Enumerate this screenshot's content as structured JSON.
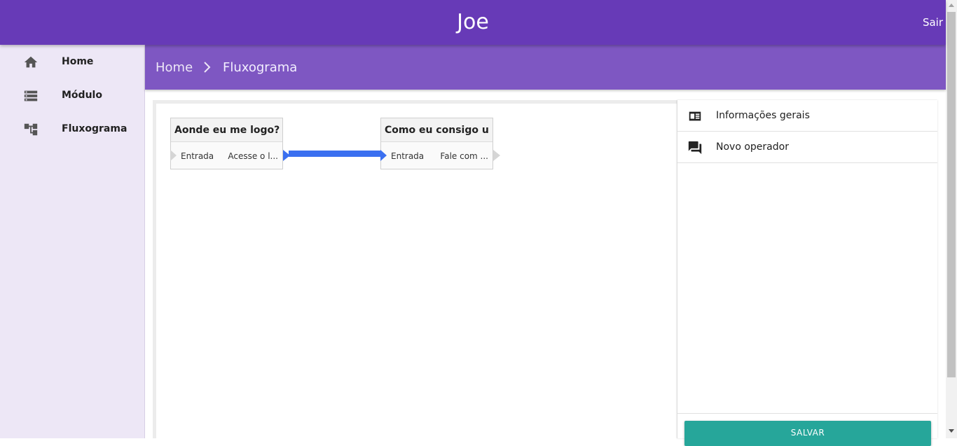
{
  "header": {
    "title": "Joe",
    "logout_label": "Sair"
  },
  "sidebar": {
    "items": [
      {
        "label": "Home",
        "icon": "home-icon"
      },
      {
        "label": "Módulo",
        "icon": "module-icon"
      },
      {
        "label": "Fluxograma",
        "icon": "flowchart-icon"
      }
    ]
  },
  "breadcrumb": {
    "home": "Home",
    "current": "Fluxograma"
  },
  "flow": {
    "nodes": [
      {
        "title": "Aonde eu me logo?",
        "input_label": "Entrada",
        "output_label": "Acesse o l..."
      },
      {
        "title": "Como eu consigo u...",
        "input_label": "Entrada",
        "output_label": "Fale com ..."
      }
    ],
    "link_color": "#3a6ff0"
  },
  "panel": {
    "items": [
      {
        "label": "Informações gerais",
        "icon": "info-card-icon"
      },
      {
        "label": "Novo operador",
        "icon": "chat-icon"
      }
    ],
    "save_label": "SALVAR"
  },
  "colors": {
    "primary": "#673ab7",
    "primary_light": "#7e57c2",
    "sidebar_bg": "#ede7f6",
    "accent": "#26a69a"
  }
}
